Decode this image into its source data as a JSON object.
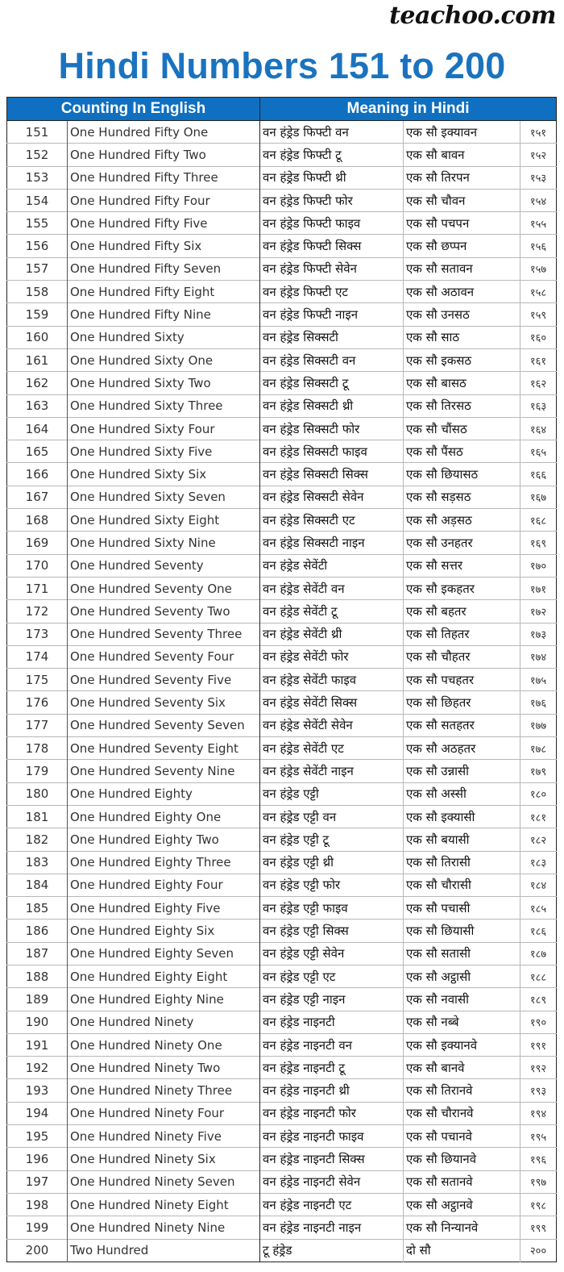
{
  "brand": "teachoo.com",
  "title": "Hindi Numbers 151 to 200",
  "table": {
    "headers": {
      "english": "Counting In English",
      "hindi": "Meaning in Hindi"
    },
    "rows": [
      {
        "num": "151",
        "english": "One Hundred Fifty One",
        "transliteration": "वन हंड्रेड फिफ्टी वन",
        "hindi": "एक सौ इक्यावन",
        "devanagari": "१५१"
      },
      {
        "num": "152",
        "english": "One Hundred Fifty Two",
        "transliteration": "वन हंड्रेड फिफ्टी टू",
        "hindi": "एक सौ बावन",
        "devanagari": "१५२"
      },
      {
        "num": "153",
        "english": "One Hundred Fifty Three",
        "transliteration": "वन हंड्रेड फिफ्टी थ्री",
        "hindi": "एक सौ तिरपन",
        "devanagari": "१५३"
      },
      {
        "num": "154",
        "english": "One Hundred Fifty Four",
        "transliteration": "वन हंड्रेड फिफ्टी फोर",
        "hindi": "एक सौ चौवन",
        "devanagari": "१५४"
      },
      {
        "num": "155",
        "english": "One Hundred Fifty Five",
        "transliteration": "वन हंड्रेड फिफ्टी फाइव",
        "hindi": "एक सौ पचपन",
        "devanagari": "१५५"
      },
      {
        "num": "156",
        "english": "One Hundred Fifty Six",
        "transliteration": "वन हंड्रेड फिफ्टी सिक्स",
        "hindi": "एक सौ छप्पन",
        "devanagari": "१५६"
      },
      {
        "num": "157",
        "english": "One Hundred Fifty Seven",
        "transliteration": "वन हंड्रेड फिफ्टी सेवेन",
        "hindi": "एक सौ सतावन",
        "devanagari": "१५७"
      },
      {
        "num": "158",
        "english": "One Hundred Fifty Eight",
        "transliteration": "वन हंड्रेड फिफ्टी एट",
        "hindi": "एक सौ अठावन",
        "devanagari": "१५८"
      },
      {
        "num": "159",
        "english": "One Hundred Fifty Nine",
        "transliteration": "वन हंड्रेड फिफ्टी नाइन",
        "hindi": "एक सौ उनसठ",
        "devanagari": "१५९"
      },
      {
        "num": "160",
        "english": "One Hundred Sixty",
        "transliteration": "वन हंड्रेड सिक्सटी",
        "hindi": "एक सौ साठ",
        "devanagari": "१६०"
      },
      {
        "num": "161",
        "english": "One Hundred Sixty One",
        "transliteration": "वन हंड्रेड सिक्सटी वन",
        "hindi": "एक सौ इकसठ",
        "devanagari": "१६१"
      },
      {
        "num": "162",
        "english": "One Hundred Sixty Two",
        "transliteration": "वन हंड्रेड सिक्सटी टू",
        "hindi": "एक सौ बासठ",
        "devanagari": "१६२"
      },
      {
        "num": "163",
        "english": "One Hundred Sixty Three",
        "transliteration": "वन हंड्रेड सिक्सटी थ्री",
        "hindi": "एक सौ तिरसठ",
        "devanagari": "१६३"
      },
      {
        "num": "164",
        "english": "One Hundred Sixty Four",
        "transliteration": "वन हंड्रेड सिक्सटी फोर",
        "hindi": "एक सौ चौंसठ",
        "devanagari": "१६४"
      },
      {
        "num": "165",
        "english": "One Hundred Sixty Five",
        "transliteration": "वन हंड्रेड सिक्सटी फाइव",
        "hindi": "एक सौ पैंसठ",
        "devanagari": "१६५"
      },
      {
        "num": "166",
        "english": "One Hundred Sixty Six",
        "transliteration": "वन हंड्रेड सिक्सटी सिक्स",
        "hindi": "एक सौ छियासठ",
        "devanagari": "१६६"
      },
      {
        "num": "167",
        "english": "One Hundred Sixty Seven",
        "transliteration": "वन हंड्रेड सिक्सटी सेवेन",
        "hindi": "एक सौ सड़सठ",
        "devanagari": "१६७"
      },
      {
        "num": "168",
        "english": "One Hundred Sixty Eight",
        "transliteration": "वन हंड्रेड सिक्सटी एट",
        "hindi": "एक सौ अड़सठ",
        "devanagari": "१६८"
      },
      {
        "num": "169",
        "english": "One Hundred Sixty Nine",
        "transliteration": "वन हंड्रेड सिक्सटी नाइन",
        "hindi": "एक सौ उनहतर",
        "devanagari": "१६९"
      },
      {
        "num": "170",
        "english": "One Hundred Seventy",
        "transliteration": "वन हंड्रेड सेवेंटी",
        "hindi": "एक सौ सत्तर",
        "devanagari": "१७०"
      },
      {
        "num": "171",
        "english": "One Hundred Seventy One",
        "transliteration": "वन हंड्रेड सेवेंटी वन",
        "hindi": "एक सौ इकहतर",
        "devanagari": "१७१"
      },
      {
        "num": "172",
        "english": "One Hundred Seventy Two",
        "transliteration": "वन हंड्रेड सेवेंटी टू",
        "hindi": "एक सौ बहतर",
        "devanagari": "१७२"
      },
      {
        "num": "173",
        "english": "One Hundred Seventy Three",
        "transliteration": "वन हंड्रेड सेवेंटी थ्री",
        "hindi": "एक सौ तिहतर",
        "devanagari": "१७३"
      },
      {
        "num": "174",
        "english": "One Hundred Seventy Four",
        "transliteration": "वन हंड्रेड सेवेंटी फोर",
        "hindi": "एक सौ चौहतर",
        "devanagari": "१७४"
      },
      {
        "num": "175",
        "english": "One Hundred Seventy Five",
        "transliteration": "वन हंड्रेड सेवेंटी फाइव",
        "hindi": "एक सौ पचहतर",
        "devanagari": "१७५"
      },
      {
        "num": "176",
        "english": "One Hundred Seventy Six",
        "transliteration": "वन हंड्रेड सेवेंटी सिक्स",
        "hindi": "एक सौ छिहतर",
        "devanagari": "१७६"
      },
      {
        "num": "177",
        "english": "One Hundred Seventy Seven",
        "transliteration": "वन हंड्रेड सेवेंटी सेवेन",
        "hindi": "एक सौ सतहतर",
        "devanagari": "१७७"
      },
      {
        "num": "178",
        "english": "One Hundred Seventy Eight",
        "transliteration": "वन हंड्रेड सेवेंटी एट",
        "hindi": "एक सौ अठहतर",
        "devanagari": "१७८"
      },
      {
        "num": "179",
        "english": "One Hundred Seventy Nine",
        "transliteration": "वन हंड्रेड सेवेंटी नाइन",
        "hindi": "एक सौ उन्नासी",
        "devanagari": "१७९"
      },
      {
        "num": "180",
        "english": "One Hundred Eighty",
        "transliteration": "वन हंड्रेड एट्टी",
        "hindi": "एक सौ अस्सी",
        "devanagari": "१८०"
      },
      {
        "num": "181",
        "english": "One Hundred Eighty One",
        "transliteration": "वन हंड्रेड एट्टी वन",
        "hindi": "एक सौ इक्यासी",
        "devanagari": "१८१"
      },
      {
        "num": "182",
        "english": "One Hundred Eighty Two",
        "transliteration": "वन हंड्रेड एट्टी टू",
        "hindi": "एक सौ बयासी",
        "devanagari": "१८२"
      },
      {
        "num": "183",
        "english": "One Hundred Eighty Three",
        "transliteration": "वन हंड्रेड एट्टी थ्री",
        "hindi": "एक सौ तिरासी",
        "devanagari": "१८३"
      },
      {
        "num": "184",
        "english": "One Hundred Eighty Four",
        "transliteration": "वन हंड्रेड एट्टी फोर",
        "hindi": "एक सौ चौरासी",
        "devanagari": "१८४"
      },
      {
        "num": "185",
        "english": "One Hundred Eighty Five",
        "transliteration": "वन हंड्रेड एट्टी फाइव",
        "hindi": "एक सौ पचासी",
        "devanagari": "१८५"
      },
      {
        "num": "186",
        "english": "One Hundred Eighty Six",
        "transliteration": "वन हंड्रेड एट्टी सिक्स",
        "hindi": "एक सौ छियासी",
        "devanagari": "१८६"
      },
      {
        "num": "187",
        "english": "One Hundred Eighty Seven",
        "transliteration": "वन हंड्रेड एट्टी सेवेन",
        "hindi": "एक सौ सतासी",
        "devanagari": "१८७"
      },
      {
        "num": "188",
        "english": "One Hundred Eighty Eight",
        "transliteration": "वन हंड्रेड एट्टी एट",
        "hindi": "एक सौ अट्ठासी",
        "devanagari": "१८८"
      },
      {
        "num": "189",
        "english": "One Hundred Eighty Nine",
        "transliteration": "वन हंड्रेड एट्टी नाइन",
        "hindi": "एक सौ नवासी",
        "devanagari": "१८९"
      },
      {
        "num": "190",
        "english": "One Hundred Ninety",
        "transliteration": "वन हंड्रेड नाइनटी",
        "hindi": "एक सौ नब्बे",
        "devanagari": "१९०"
      },
      {
        "num": "191",
        "english": "One Hundred Ninety One",
        "transliteration": "वन हंड्रेड नाइनटी वन",
        "hindi": "एक सौ इक्यानवे",
        "devanagari": "१९१"
      },
      {
        "num": "192",
        "english": "One Hundred Ninety Two",
        "transliteration": "वन हंड्रेड नाइनटी टू",
        "hindi": "एक सौ बानवे",
        "devanagari": "१९२"
      },
      {
        "num": "193",
        "english": "One Hundred Ninety Three",
        "transliteration": "वन हंड्रेड नाइनटी थ्री",
        "hindi": "एक सौ तिरानवे",
        "devanagari": "१९३"
      },
      {
        "num": "194",
        "english": "One Hundred Ninety Four",
        "transliteration": "वन हंड्रेड नाइनटी फोर",
        "hindi": "एक सौ चौरानवे",
        "devanagari": "१९४"
      },
      {
        "num": "195",
        "english": "One Hundred Ninety Five",
        "transliteration": "वन हंड्रेड नाइनटी फाइव",
        "hindi": "एक सौ पचानवे",
        "devanagari": "१९५"
      },
      {
        "num": "196",
        "english": "One Hundred Ninety Six",
        "transliteration": "वन हंड्रेड नाइनटी सिक्स",
        "hindi": "एक सौ छियानवे",
        "devanagari": "१९६"
      },
      {
        "num": "197",
        "english": "One Hundred Ninety Seven",
        "transliteration": "वन हंड्रेड नाइनटी सेवेन",
        "hindi": "एक सौ सतानवे",
        "devanagari": "१९७"
      },
      {
        "num": "198",
        "english": "One Hundred Ninety Eight",
        "transliteration": "वन हंड्रेड नाइनटी एट",
        "hindi": "एक सौ अट्ठानवे",
        "devanagari": "१९८"
      },
      {
        "num": "199",
        "english": "One Hundred Ninety Nine",
        "transliteration": "वन हंड्रेड नाइनटी नाइन",
        "hindi": "एक सौ निन्यानवे",
        "devanagari": "१९९"
      },
      {
        "num": "200",
        "english": "Two Hundred",
        "transliteration": "टू हंड्रेड",
        "hindi": "दो सौ",
        "devanagari": "२००"
      }
    ]
  },
  "colors": {
    "title": "#1a73bf",
    "header_bg": "#0f6fc0",
    "header_text": "#ffffff"
  }
}
